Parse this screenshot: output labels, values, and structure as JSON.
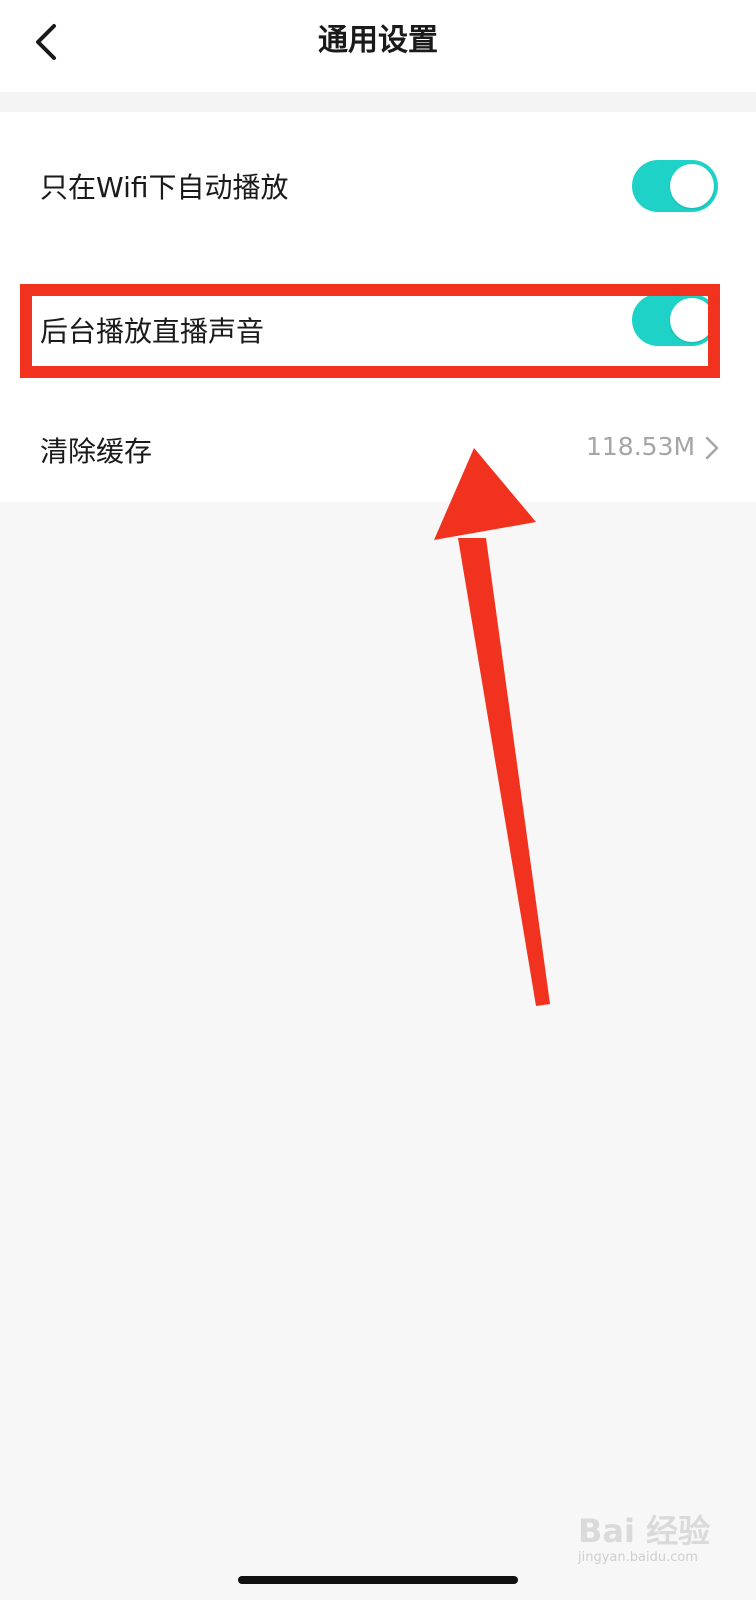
{
  "header": {
    "title": "通用设置",
    "back_icon": "chevron-left-icon"
  },
  "settings": {
    "wifi_autoplay": {
      "label": "只在Wifi下自动播放",
      "enabled": true
    },
    "background_audio": {
      "label": "后台播放直播声音",
      "enabled": true
    },
    "clear_cache": {
      "label": "清除缓存",
      "value": "118.53M",
      "icon": "chevron-right-icon"
    }
  },
  "colors": {
    "toggle_on": "#1ed2c8",
    "annotation_red": "#f0321e",
    "page_background": "#f7f7f7"
  },
  "watermark": {
    "text": "Bai 经验",
    "sub": "jingyan.baidu.com"
  }
}
